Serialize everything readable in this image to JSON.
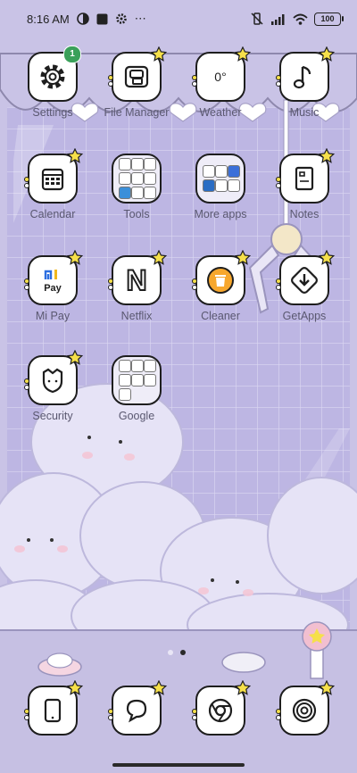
{
  "status_bar": {
    "time": "8:16 AM",
    "battery": "100"
  },
  "apps": [
    {
      "id": "settings",
      "label": "Settings",
      "badge": "1"
    },
    {
      "id": "file-manager",
      "label": "File Manager"
    },
    {
      "id": "weather",
      "label": "Weather",
      "tile_text": "0°"
    },
    {
      "id": "music",
      "label": "Music"
    },
    {
      "id": "calendar",
      "label": "Calendar"
    },
    {
      "id": "tools",
      "label": "Tools"
    },
    {
      "id": "more-apps",
      "label": "More apps"
    },
    {
      "id": "notes",
      "label": "Notes"
    },
    {
      "id": "mi-pay",
      "label": "Mi Pay",
      "tile_text": "Pay"
    },
    {
      "id": "netflix",
      "label": "Netflix",
      "tile_text": "N"
    },
    {
      "id": "cleaner",
      "label": "Cleaner"
    },
    {
      "id": "getapps",
      "label": "GetApps"
    },
    {
      "id": "security",
      "label": "Security"
    },
    {
      "id": "google",
      "label": "Google"
    }
  ],
  "dock": [
    {
      "id": "phone",
      "icon": "phone-icon"
    },
    {
      "id": "messages",
      "icon": "chat-bubble-icon"
    },
    {
      "id": "chrome",
      "icon": "chrome-icon"
    },
    {
      "id": "camera",
      "icon": "camera-icon"
    }
  ],
  "page_indicator": {
    "pages": 2,
    "current": 2
  },
  "colors": {
    "background": "#c9c3e6",
    "tile_border": "#1e1e1e",
    "star": "#f6e04a",
    "label": "#5a5870",
    "badge": "#3aa05a"
  }
}
